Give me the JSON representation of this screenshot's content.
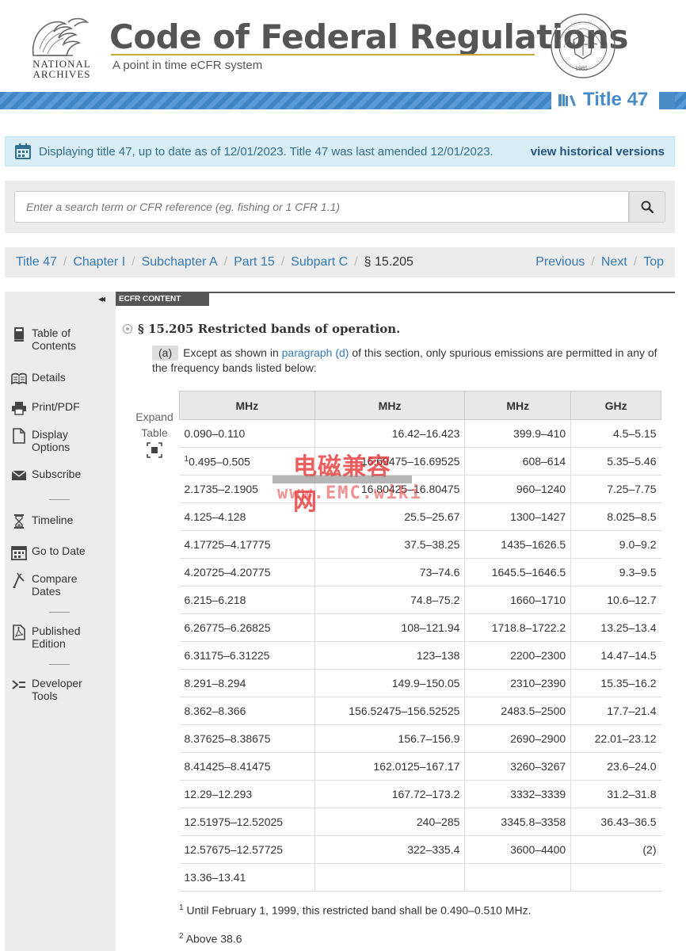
{
  "header": {
    "agency": "NATIONAL ARCHIVES",
    "title": "Code of Federal Regulations",
    "subtitle": "A point in time eCFR system",
    "seal_text": "NATIONAL ARCHIVES AND RECORDS ADMINISTRATION",
    "seal_year": "1985",
    "title_tab": "Title 47",
    "brand_color": "#4a8cc8"
  },
  "info_bar": {
    "message": "Displaying title 47, up to date as of 12/01/2023. Title 47 was last amended 12/01/2023.",
    "link": "view historical versions"
  },
  "search": {
    "placeholder": "Enter a search term or CFR reference (eg. fishing or 1 CFR 1.1)"
  },
  "breadcrumb": {
    "items": [
      "Title 47",
      "Chapter I",
      "Subchapter A",
      "Part 15",
      "Subpart C"
    ],
    "current": "§ 15.205",
    "previous": "Previous",
    "next": "Next",
    "top": "Top"
  },
  "sidebar": {
    "collapse": "◂◂",
    "items": [
      {
        "label": "Table of Contents",
        "icon": "book-icon"
      },
      {
        "label": "Details",
        "icon": "open-book-icon"
      },
      {
        "label": "Print/PDF",
        "icon": "printer-icon"
      },
      {
        "label": "Display Options",
        "icon": "document-icon"
      },
      {
        "label": "Subscribe",
        "icon": "envelope-icon"
      },
      {
        "label": "Timeline",
        "icon": "hourglass-icon"
      },
      {
        "label": "Go to Date",
        "icon": "calendar-icon"
      },
      {
        "label": "Compare Dates",
        "icon": "compare-icon"
      },
      {
        "label": "Published Edition",
        "icon": "pdf-icon"
      },
      {
        "label": "Developer Tools",
        "icon": "terminal-icon"
      }
    ]
  },
  "content": {
    "tag": "ECFR CONTENT",
    "section_title": "§ 15.205 Restricted bands of operation.",
    "para_label": "(a)",
    "para_pre": "Except as shown in ",
    "para_link": "paragraph (d)",
    "para_post": " of this section, only spurious emissions are permitted in any of the frequency bands listed below:",
    "expand_line1": "Expand",
    "expand_line2": "Table",
    "table": {
      "headers": [
        "MHz",
        "MHz",
        "MHz",
        "GHz"
      ],
      "rows": [
        [
          "0.090–0.110",
          "16.42–16.423",
          "399.9–410",
          "4.5–5.15"
        ],
        [
          "0.495–0.505",
          "16.69475–16.69525",
          "608–614",
          "5.35–5.46"
        ],
        [
          "2.1735–2.1905",
          "16.80425–16.80475",
          "960–1240",
          "7.25–7.75"
        ],
        [
          "4.125–4.128",
          "25.5–25.67",
          "1300–1427",
          "8.025–8.5"
        ],
        [
          "4.17725–4.17775",
          "37.5–38.25",
          "1435–1626.5",
          "9.0–9.2"
        ],
        [
          "4.20725–4.20775",
          "73–74.6",
          "1645.5–1646.5",
          "9.3–9.5"
        ],
        [
          "6.215–6.218",
          "74.8–75.2",
          "1660–1710",
          "10.6–12.7"
        ],
        [
          "6.26775–6.26825",
          "108–121.94",
          "1718.8–1722.2",
          "13.25–13.4"
        ],
        [
          "6.31175–6.31225",
          "123–138",
          "2200–2300",
          "14.47–14.5"
        ],
        [
          "8.291–8.294",
          "149.9–150.05",
          "2310–2390",
          "15.35–16.2"
        ],
        [
          "8.362–8.366",
          "156.52475–156.52525",
          "2483.5–2500",
          "17.7–21.4"
        ],
        [
          "8.37625–8.38675",
          "156.7–156.9",
          "2690–2900",
          "22.01–23.12"
        ],
        [
          "8.41425–8.41475",
          "162.0125–167.17",
          "3260–3267",
          "23.6–24.0"
        ],
        [
          "12.29–12.293",
          "167.72–173.2",
          "3332–3339",
          "31.2–31.8"
        ],
        [
          "12.51975–12.52025",
          "240–285",
          "3345.8–3358",
          "36.43–36.5"
        ],
        [
          "12.57675–12.57725",
          "322–335.4",
          "3600–4400",
          "(2)"
        ],
        [
          "13.36–13.41",
          "",
          "",
          ""
        ]
      ],
      "row2_marker": "1"
    },
    "footnote1_num": "1",
    "footnote1": "Until February 1, 1999, this restricted band shall be 0.490–0.510 MHz.",
    "footnote2_num": "2",
    "footnote2": "Above 38.6"
  },
  "watermark": {
    "line1": "电磁兼容网",
    "line2": "www.EMC.wiki"
  }
}
